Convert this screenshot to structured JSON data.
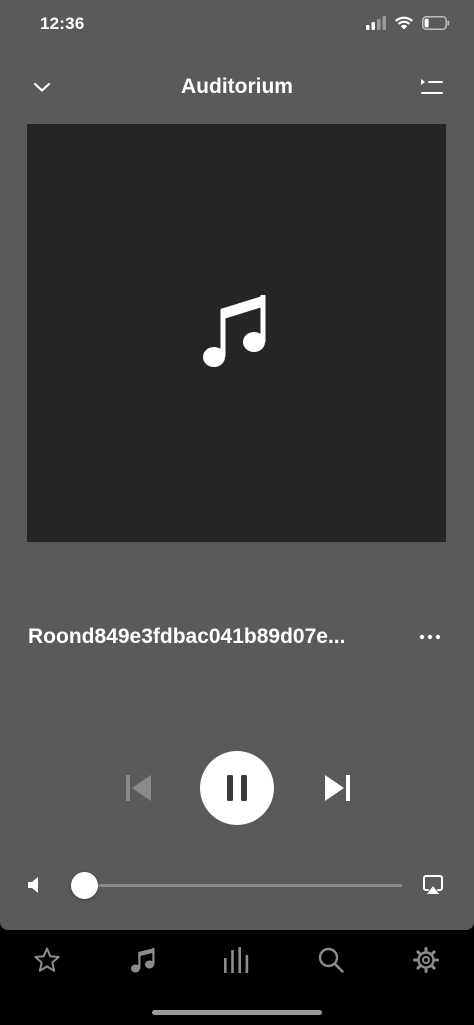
{
  "status_bar": {
    "time": "12:36",
    "icons": [
      "cellular-signal-icon",
      "wifi-icon",
      "battery-icon"
    ],
    "battery_level": 0.2
  },
  "header": {
    "title": "Auditorium",
    "left_icon": "chevron-down-icon",
    "right_icon": "queue-list-icon"
  },
  "album_art": {
    "placeholder_icon": "music-note-icon"
  },
  "track": {
    "title": "Roond849e3fdbac041b89d07e...",
    "more_icon": "ellipsis-icon"
  },
  "transport": {
    "previous_icon": "skip-previous-icon",
    "previous_enabled": false,
    "play_state_icon": "pause-icon",
    "next_icon": "skip-next-icon"
  },
  "volume": {
    "level": 0.0,
    "icon": "speaker-icon",
    "output_icon": "airplay-icon"
  },
  "tabs": [
    {
      "id": "favorites",
      "icon": "star-icon"
    },
    {
      "id": "music",
      "icon": "music-note-icon"
    },
    {
      "id": "now-playing",
      "icon": "equalizer-icon"
    },
    {
      "id": "search",
      "icon": "search-icon"
    },
    {
      "id": "settings",
      "icon": "gear-icon"
    }
  ],
  "colors": {
    "background": "#5a5a5a",
    "art_background": "#252525",
    "tab_bar": "#000000",
    "disabled_control": "#8a8a8a",
    "foreground": "#ffffff",
    "tab_icon": "#8c8c8c"
  }
}
